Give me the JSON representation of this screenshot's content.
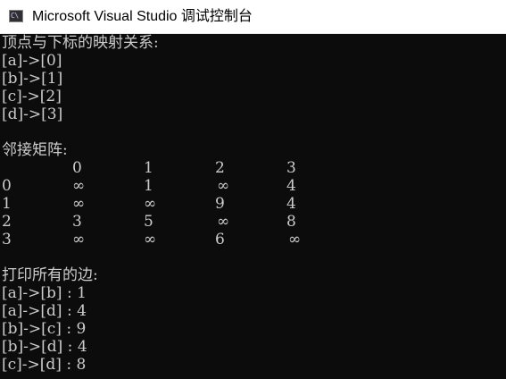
{
  "window": {
    "title": "Microsoft Visual Studio 调试控制台",
    "icon_glyph": "C\\",
    "icon": "console-app-icon"
  },
  "console": {
    "mapping_header": "顶点与下标的映射关系:",
    "mappings": [
      "[a]->[0]",
      "[b]->[1]",
      "[c]->[2]",
      "[d]->[3]"
    ],
    "matrix_header": "邻接矩阵:",
    "matrix": {
      "col_headers": [
        "0",
        "1",
        "2",
        "3"
      ],
      "rows": [
        {
          "label": "0",
          "cells": [
            "∞",
            "1",
            "∞",
            "4"
          ]
        },
        {
          "label": "1",
          "cells": [
            "∞",
            "∞",
            "9",
            "4"
          ]
        },
        {
          "label": "2",
          "cells": [
            "3",
            "5",
            "∞",
            "8"
          ]
        },
        {
          "label": "3",
          "cells": [
            "∞",
            "∞",
            "6",
            "∞"
          ]
        }
      ]
    },
    "edges_header": "打印所有的边:",
    "edges": [
      "[a]->[b] : 1",
      "[a]->[d] : 4",
      "[b]->[c] : 9",
      "[b]->[d] : 4",
      "[c]->[d] : 8"
    ]
  },
  "colors": {
    "console_bg": "#0c0c0c",
    "console_fg": "#cccccc",
    "titlebar_bg": "#ffffff"
  }
}
